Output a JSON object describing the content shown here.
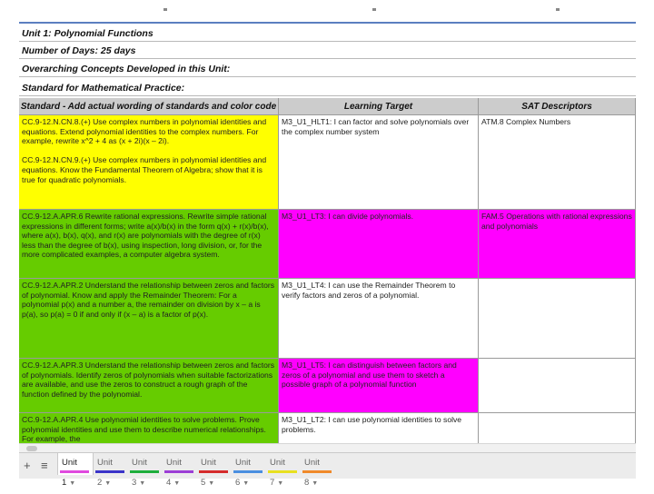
{
  "sheet": {
    "info_rows": [
      "Unit 1: Polynomial Functions",
      "Number of Days: 25 days",
      "Overarching Concepts Developed in this Unit:",
      "Standard for Mathematical Practice:"
    ],
    "headers": {
      "standard": "Standard - Add actual wording of standards and color code",
      "learning_target": "Learning Target",
      "sat": "SAT Descriptors"
    },
    "rows": [
      {
        "standard": "CC.9-12.N.CN.8.(+) Use complex numbers in polynomial identities and equations. Extend polynomial identities to the complex numbers. For example, rewrite x^2 + 4 as (x + 2i)(x – 2i).\n\nCC.9-12.N.CN.9.(+) Use complex numbers in polynomial identities and equations. Know the Fundamental Theorem of Algebra; show that it is true for quadratic polynomials.",
        "target": "M3_U1_HLT1: I can factor and solve polynomials over the complex number system",
        "sat": "ATM.8 Complex Numbers",
        "colors": {
          "standard": "#ffff00",
          "target": "#ffffff",
          "sat": "#ffffff"
        }
      },
      {
        "standard": "CC.9-12.A.APR.6 Rewrite rational expressions. Rewrite simple rational expressions in different forms; write a(x)/b(x) in the form q(x) + r(x)/b(x), where a(x), b(x), q(x), and r(x) are polynomials with the degree of r(x) less than the degree of b(x), using inspection, long division, or, for the more complicated examples, a computer algebra system.",
        "target": "M3_U1_LT3: I can divide polynomials.",
        "sat": "FAM.5 Operations with rational expressions and polynomials",
        "colors": {
          "standard": "#66cc00",
          "target": "#ff00ff",
          "sat": "#ff00ff"
        }
      },
      {
        "standard": "CC.9-12.A.APR.2 Understand the relationship between zeros and factors of polynomial. Know and apply the Remainder Theorem: For a polynomial p(x) and a number a, the remainder on division by x – a is p(a), so p(a) = 0 if and only if (x – a) is a factor of p(x).",
        "target": "M3_U1_LT4: I can use the Remainder Theorem to verify factors and zeros of a polynomial.",
        "sat": "",
        "colors": {
          "standard": "#66cc00",
          "target": "#ffffff",
          "sat": "#ffffff"
        }
      },
      {
        "standard": "CC.9-12.A.APR.3 Understand the relationship between zeros and factors of polynomials. Identify zeros of polynomials when suitable factorizations are available, and use the zeros to construct a rough graph of the function defined by the polynomial.",
        "target": "M3_U1_LT5: I can distinguish between factors and zeros of a polynomial and use them to sketch a possible graph of a polynomial function",
        "sat": "",
        "colors": {
          "standard": "#66cc00",
          "target": "#ff00ff",
          "sat": "#ffffff"
        }
      },
      {
        "standard": "CC.9-12.A.APR.4 Use polynomial identities to solve problems. Prove polynomial identities and use them to describe numerical relationships. For example, the",
        "target": "M3_U1_LT2: I can use polynomial identities to solve problems.",
        "sat": "",
        "colors": {
          "standard": "#66cc00",
          "target": "#ffffff",
          "sat": "#ffffff"
        }
      }
    ]
  },
  "toolbar": {
    "add_glyph": "+",
    "list_glyph": "≡",
    "tabs": [
      {
        "label": "Unit 1",
        "color": "#e04adf",
        "active": true
      },
      {
        "label": "Unit 2",
        "color": "#3b34c9",
        "active": false
      },
      {
        "label": "Unit 3",
        "color": "#1eae3c",
        "active": false
      },
      {
        "label": "Unit 4",
        "color": "#9c3ed6",
        "active": false
      },
      {
        "label": "Unit 5",
        "color": "#d52b2b",
        "active": false
      },
      {
        "label": "Unit 6",
        "color": "#4a8fe0",
        "active": false
      },
      {
        "label": "Unit 7",
        "color": "#e8e020",
        "active": false
      },
      {
        "label": "Unit 8",
        "color": "#f08a2a",
        "active": false
      }
    ],
    "caret_glyph": "▼"
  }
}
